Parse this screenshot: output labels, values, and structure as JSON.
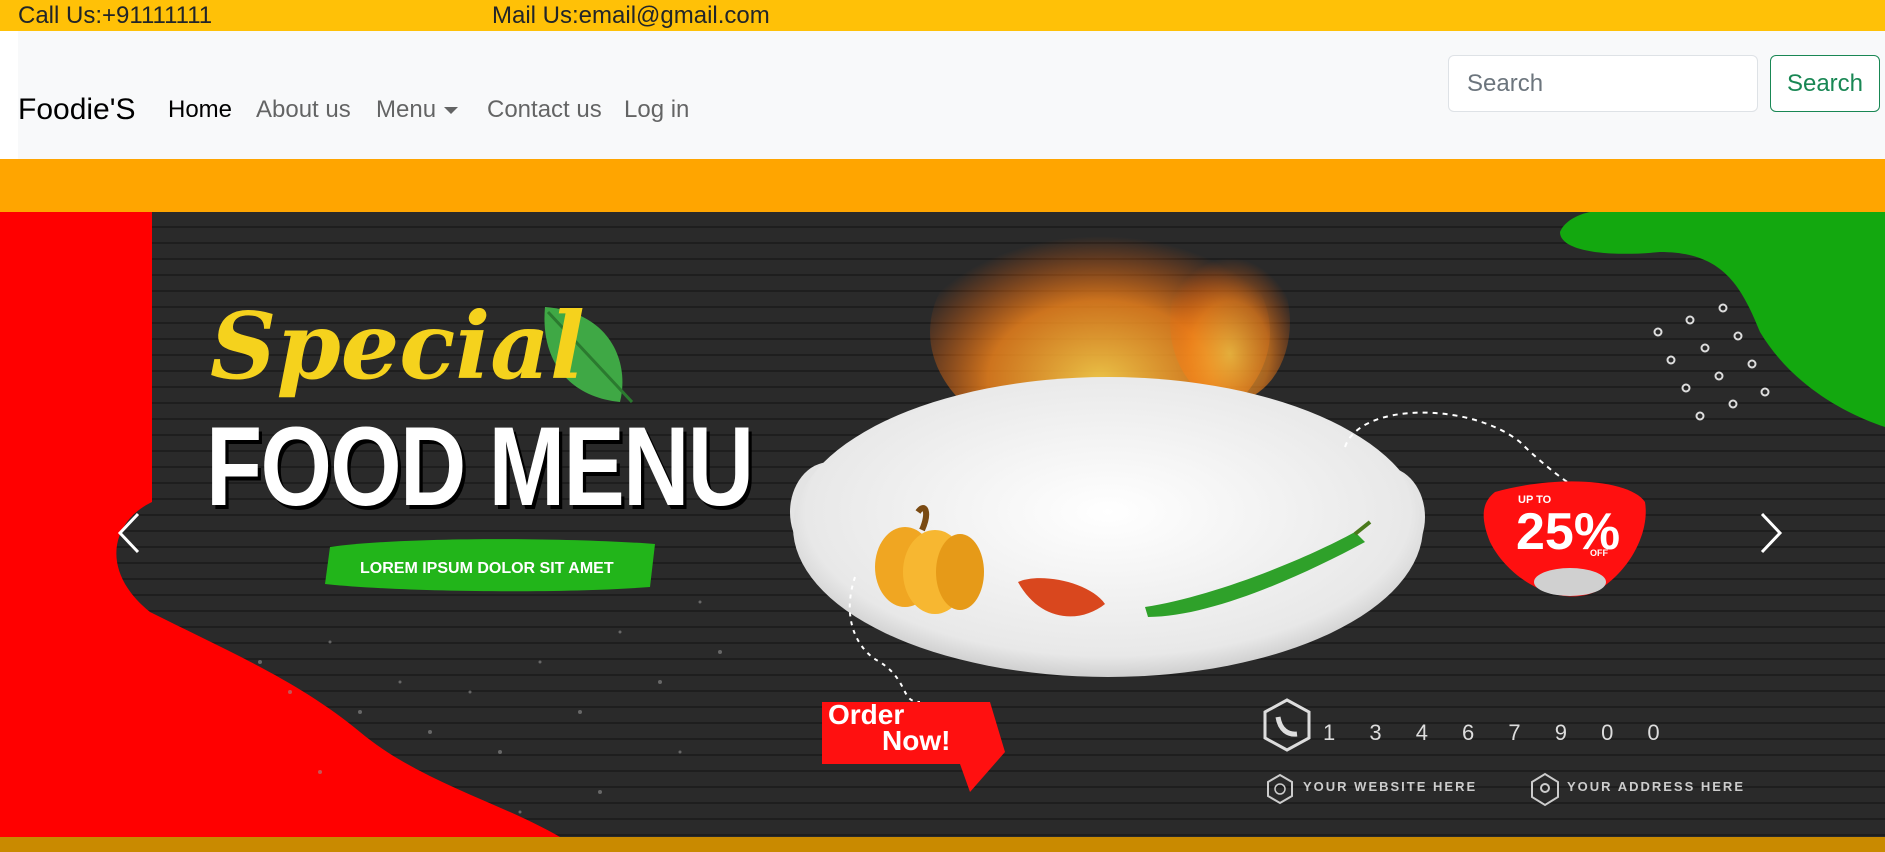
{
  "topbar": {
    "call": "Call Us:+91111111",
    "mail": "Mail Us:email@gmail.com"
  },
  "navbar": {
    "brand": "Foodie'S",
    "links": [
      {
        "label": "Home",
        "active": true
      },
      {
        "label": "About us"
      },
      {
        "label": "Menu",
        "dropdown": true
      },
      {
        "label": "Contact us"
      },
      {
        "label": "Log in"
      }
    ],
    "search": {
      "placeholder": "Search",
      "button_label": "Search"
    }
  },
  "banner": {
    "script_title": "Special",
    "title": "FOOD MENU",
    "tagline": "LOREM IPSUM DOLOR SIT AMET",
    "order_line1": "Order",
    "order_line2": "Now!",
    "discount_top": "UP TO",
    "discount": "25%",
    "discount_off": "OFF",
    "phone": "1 3 4 6 7 9 0 0",
    "website": "YOUR WEBSITE HERE",
    "address": "YOUR ADDRESS HERE"
  },
  "carousel": {
    "prev_icon": "chevron-left-icon",
    "next_icon": "chevron-right-icon"
  },
  "colors": {
    "topbar_bg": "#ffc107",
    "navbar_bg": "#f8f9fa",
    "band": "#ffa500",
    "search_accent": "#198754",
    "hero_red": "#ff0000",
    "hero_green": "#13a80f"
  }
}
